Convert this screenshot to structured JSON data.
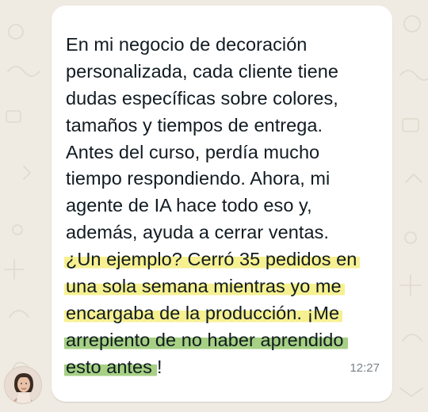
{
  "chat": {
    "message_lines": [
      "En mi negocio de decoración",
      "personalizada, cada cliente tiene",
      "dudas específicas sobre colores,",
      "tamaños y tiempos de entrega.",
      "Antes del curso, perdía mucho",
      "tiempo respondiendo. Ahora, mi",
      "agente de IA hace todo eso y,",
      "además, ayuda a cerrar ventas."
    ],
    "highlight_yellow_lines": [
      "¿Un ejemplo? Cerró 35 pedidos en",
      "una sola semana mientras yo me",
      "encargaba de la producción. ¡Me"
    ],
    "highlight_green_lines": [
      "arrepiento de no haber aprendido",
      "esto antes"
    ],
    "closing_text": "!",
    "timestamp": "12:27"
  },
  "colors": {
    "wallpaper": "#efeae2",
    "bubble": "#ffffff",
    "highlight_yellow": "#f4ee7e",
    "highlight_green": "#96c86e",
    "timestamp": "#7a8288"
  },
  "icons": {
    "avatar": "contact-avatar-photo"
  }
}
